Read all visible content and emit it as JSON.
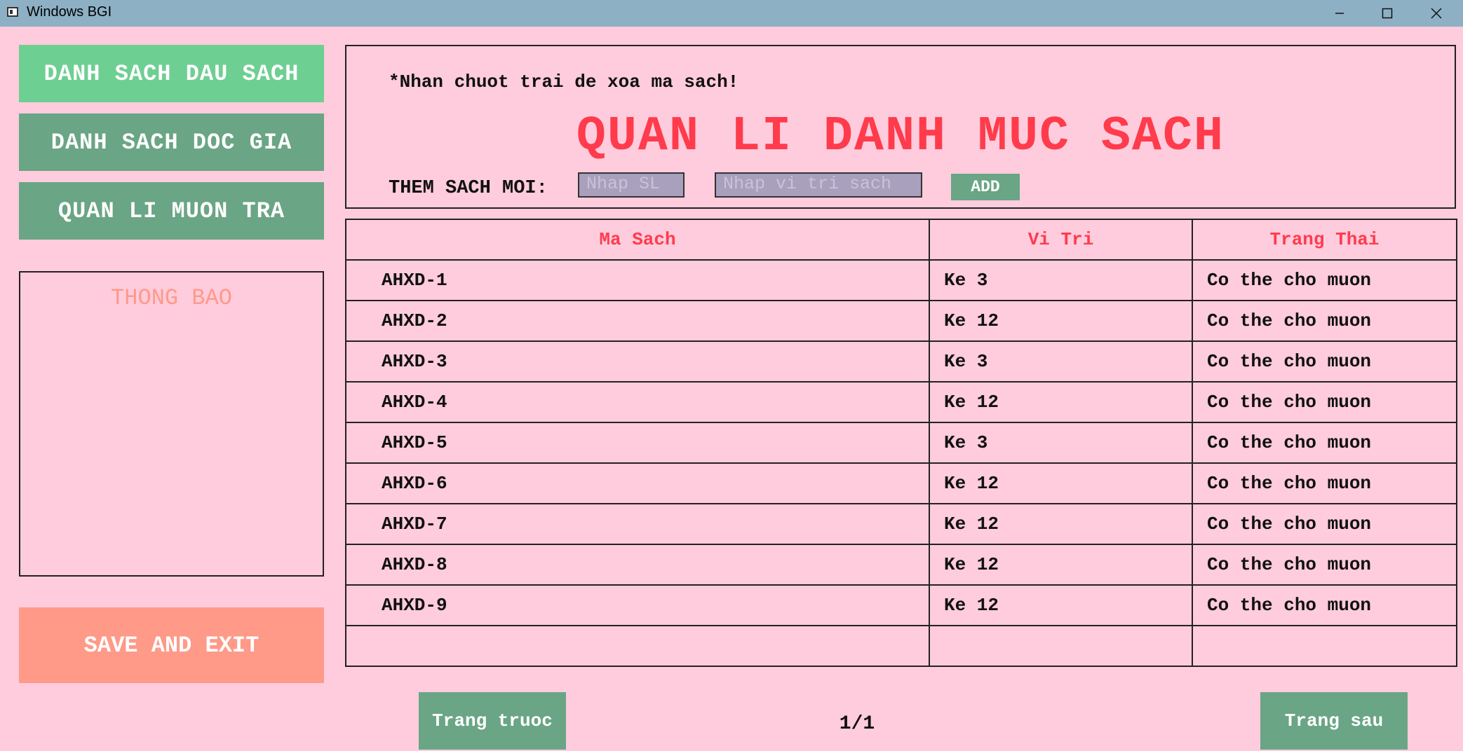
{
  "window": {
    "title": "Windows BGI"
  },
  "sidebar": {
    "buttons": [
      {
        "label": "DANH SACH DAU SACH"
      },
      {
        "label": "DANH SACH DOC GIA"
      },
      {
        "label": "QUAN LI MUON TRA"
      }
    ],
    "notice_title": "THONG BAO",
    "save_label": "SAVE AND EXIT"
  },
  "header": {
    "hint": "*Nhan chuot trai de xoa ma sach!",
    "title": "QUAN LI DANH MUC SACH",
    "add_label": "THEM SACH MOI:",
    "quantity_placeholder": "Nhap SL",
    "location_placeholder": "Nhap vi tri sach",
    "add_button": "ADD"
  },
  "table": {
    "columns": [
      "Ma Sach",
      "Vi Tri",
      "Trang Thai"
    ],
    "rows": [
      [
        "AHXD-1",
        "Ke 3",
        "Co the cho muon"
      ],
      [
        "AHXD-2",
        "Ke 12",
        "Co the cho muon"
      ],
      [
        "AHXD-3",
        "Ke 3",
        "Co the cho muon"
      ],
      [
        "AHXD-4",
        "Ke 12",
        "Co the cho muon"
      ],
      [
        "AHXD-5",
        "Ke 3",
        "Co the cho muon"
      ],
      [
        "AHXD-6",
        "Ke 12",
        "Co the cho muon"
      ],
      [
        "AHXD-7",
        "Ke 12",
        "Co the cho muon"
      ],
      [
        "AHXD-8",
        "Ke 12",
        "Co the cho muon"
      ],
      [
        "AHXD-9",
        "Ke 12",
        "Co the cho muon"
      ],
      [
        "",
        "",
        ""
      ]
    ]
  },
  "pagination": {
    "prev_label": "Trang truoc",
    "next_label": "Trang sau",
    "page_indicator": "1/1"
  }
}
